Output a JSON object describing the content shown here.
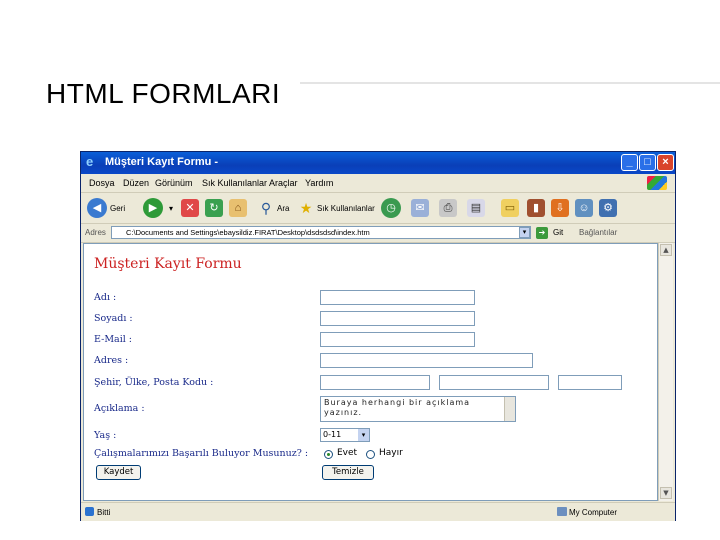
{
  "slide": {
    "title": "HTML FORMLARI"
  },
  "window": {
    "title": "Müşteri Kayıt Formu -",
    "menu": [
      "Dosya",
      "Düzen",
      "Görünüm",
      "Sık Kullanılanlar",
      "Araçlar",
      "Yardım"
    ],
    "toolbar": {
      "back_label": "Geri",
      "search_label": "Ara",
      "favorites_label": "Sık Kullanılanlar"
    },
    "address": {
      "label": "Adres",
      "value": "C:\\Documents and Settings\\ebaysildiz.FIRAT\\Desktop\\dsdsdsd\\index.htm",
      "go_label": "Git",
      "links_label": "Bağlantılar"
    },
    "status": {
      "left": "Bitti",
      "right": "My Computer"
    }
  },
  "form": {
    "heading": "Müşteri Kayıt Formu",
    "fields": {
      "ad": "Adı :",
      "soyad": "Soyadı :",
      "email": "E-Mail :",
      "adres": "Adres :",
      "sehir": "Şehir, Ülke, Posta Kodu :",
      "aciklama": "Açıklama :",
      "yas": "Yaş :",
      "question": "Çalışmalarımızı Başarılı Buluyor Musunuz? :"
    },
    "aciklama_value": "Buraya herhangi bir açıklama yazınız.",
    "yas_value": "0-11",
    "radio": {
      "yes": "Evet",
      "no": "Hayır",
      "selected": "Evet"
    },
    "buttons": {
      "submit": "Kaydet",
      "reset": "Temizle"
    }
  }
}
